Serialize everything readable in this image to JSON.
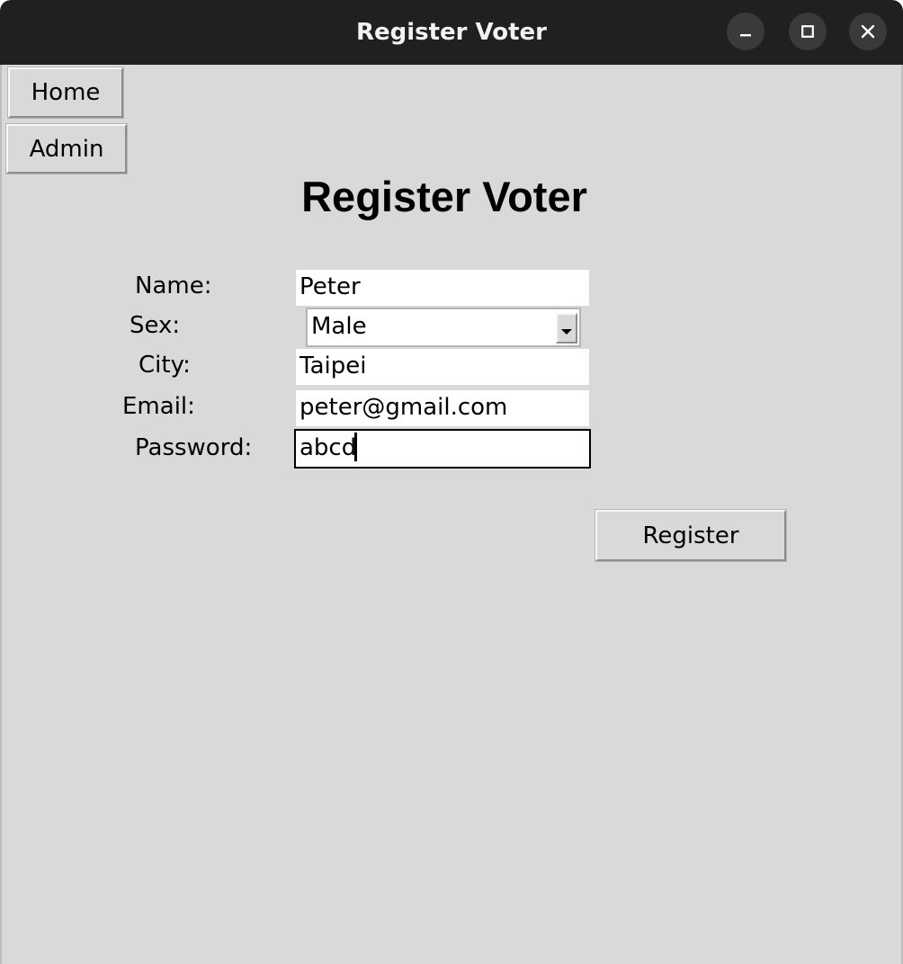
{
  "window": {
    "title": "Register Voter",
    "controls": {
      "minimize_icon": "minimize-icon",
      "maximize_icon": "maximize-icon",
      "close_icon": "close-icon"
    }
  },
  "nav": {
    "home_label": "Home",
    "admin_label": "Admin"
  },
  "form": {
    "heading": "Register Voter",
    "name": {
      "label": "Name:",
      "value": "Peter"
    },
    "sex": {
      "label": "Sex:",
      "value": "Male"
    },
    "city": {
      "label": "City:",
      "value": "Taipei"
    },
    "email": {
      "label": "Email:",
      "value": "peter@gmail.com"
    },
    "password": {
      "label": "Password:",
      "value": "abcd"
    },
    "register_label": "Register"
  },
  "colors": {
    "titlebar": "#202020",
    "window_bg": "#d9d9d9",
    "entry_bg": "#ffffff"
  }
}
